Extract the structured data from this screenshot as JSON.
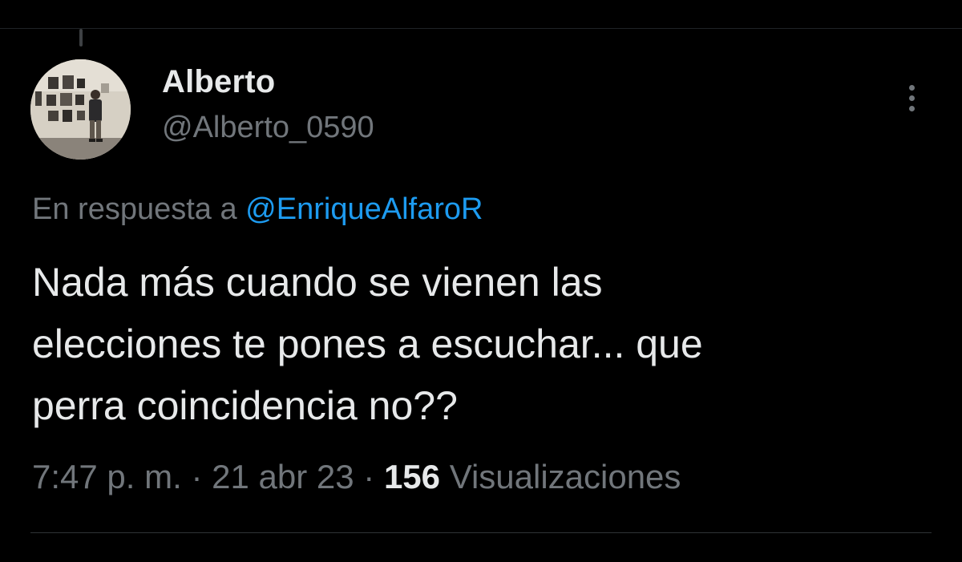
{
  "tweet": {
    "author": {
      "display_name": "Alberto",
      "handle": "@Alberto_0590",
      "avatar": "gallery-photo"
    },
    "reply_to": {
      "prefix": "En respuesta a",
      "mention": "@EnriqueAlfaroR"
    },
    "text_lines": [
      "Nada más cuando se vienen las",
      "elecciones te pones a escuchar... que",
      "perra coincidencia no??"
    ],
    "meta": {
      "time": "7:47 p. m.",
      "separator": "·",
      "date": "21 abr 23",
      "views_count": "156",
      "views_label": "Visualizaciones"
    },
    "more_icon": "more-vertical-icon"
  },
  "colors": {
    "background": "#000000",
    "primary_text": "#e7e9ea",
    "secondary_text": "#71767b",
    "link": "#1d9bf0",
    "divider": "#2f3336"
  }
}
